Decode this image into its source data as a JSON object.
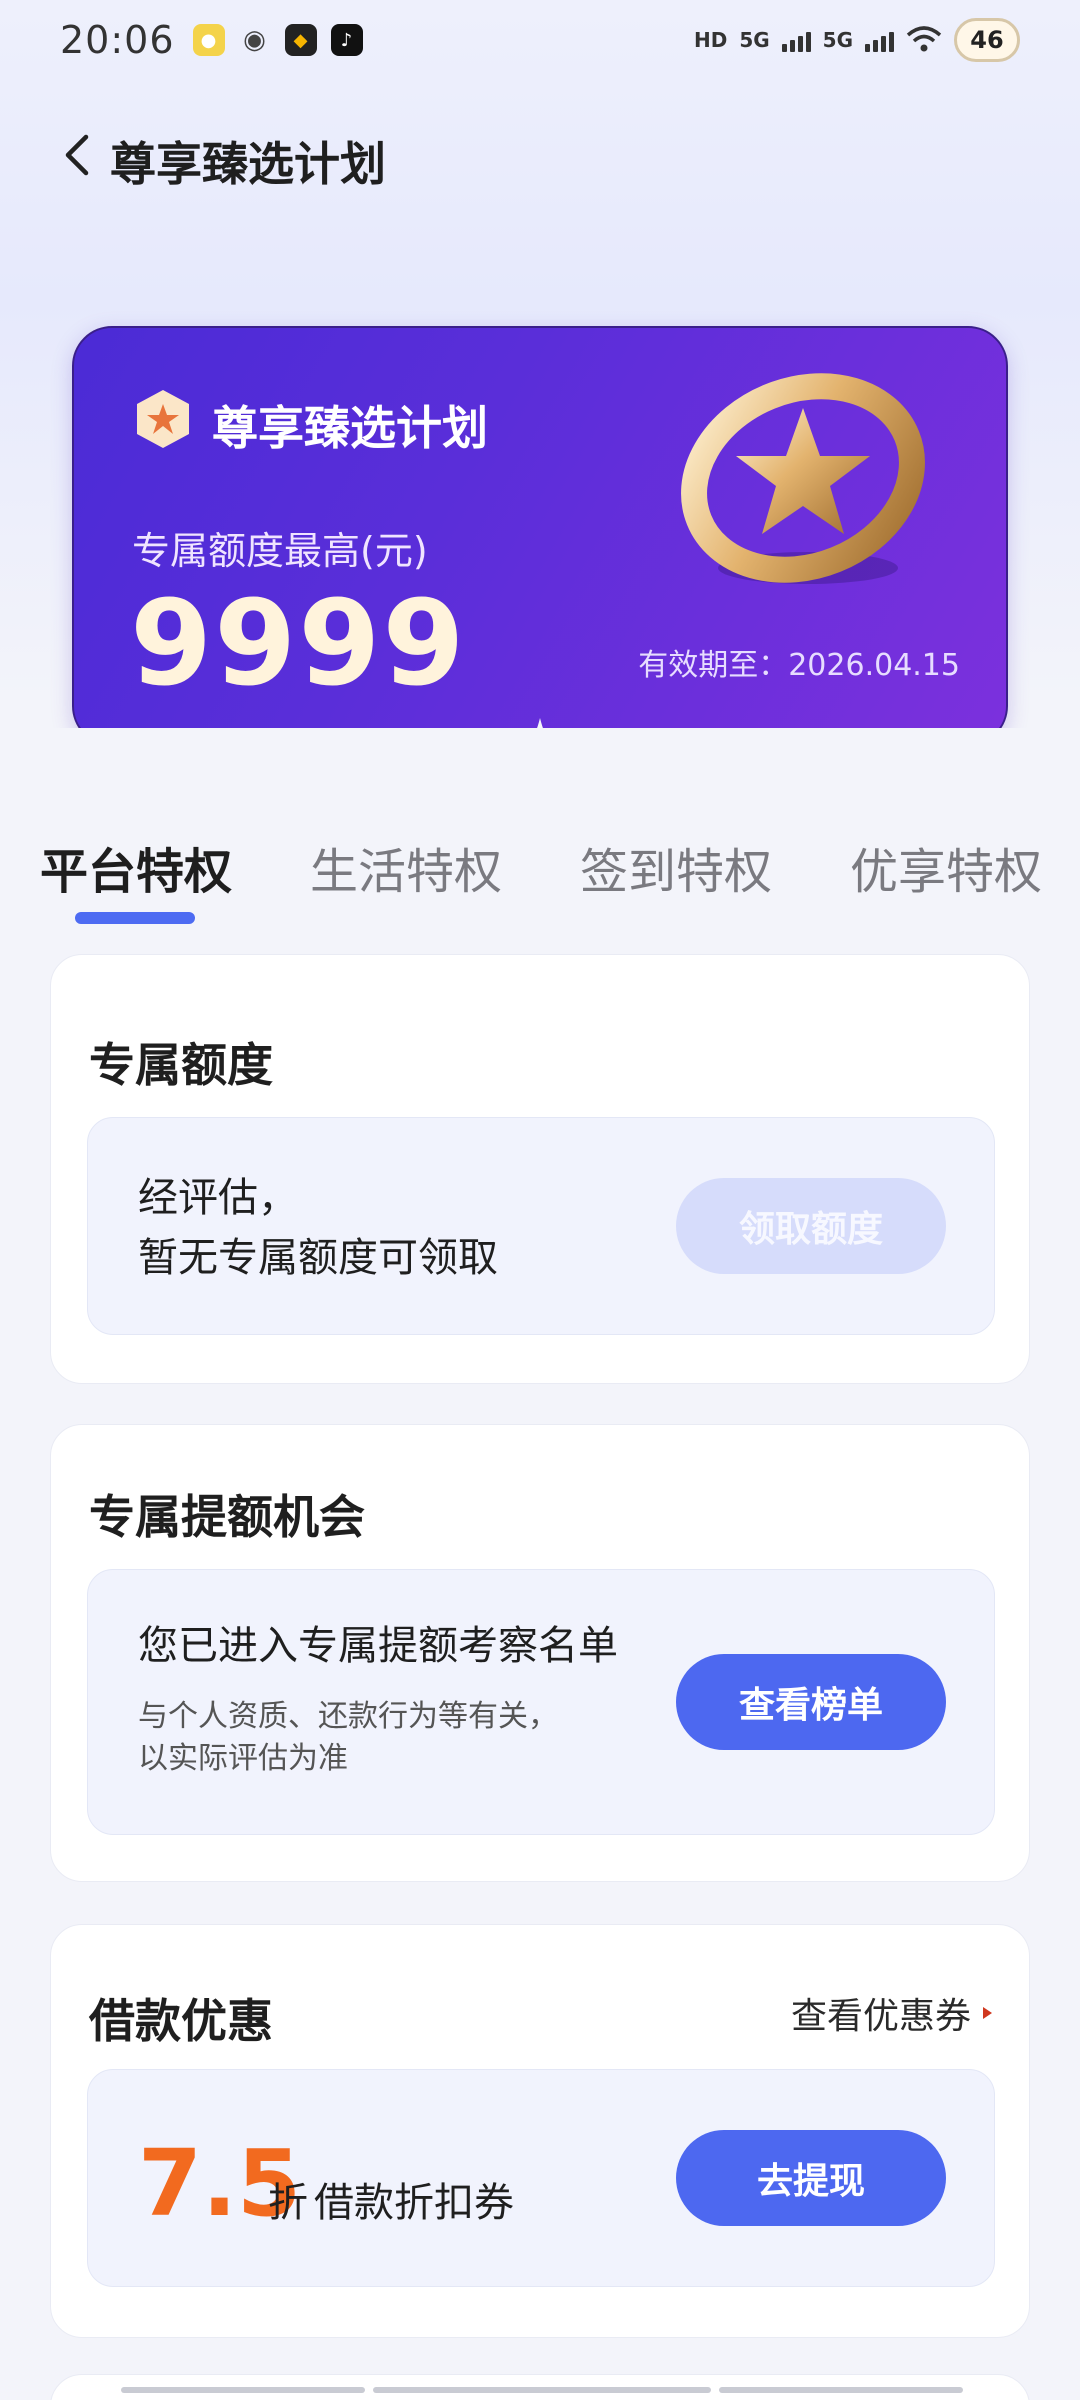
{
  "status": {
    "time": "20:06",
    "battery": "46",
    "hd": "HD",
    "net1": "5G",
    "net2": "5G"
  },
  "nav": {
    "title": "尊享臻选计划"
  },
  "hero": {
    "title": "尊享臻选计划",
    "subtitle": "专属额度最高(元)",
    "amount": "9999",
    "valid": "有效期至：2026.04.15"
  },
  "tabs": [
    {
      "label": "平台特权",
      "active": true
    },
    {
      "label": "生活特权",
      "active": false
    },
    {
      "label": "签到特权",
      "active": false
    },
    {
      "label": "优享特权",
      "active": false
    }
  ],
  "card_limit": {
    "title": "专属额度",
    "line1": "经评估，",
    "line2": "暂无专属额度可领取",
    "button": "领取额度"
  },
  "card_raise": {
    "title": "专属提额机会",
    "heading": "您已进入专属提额考察名单",
    "note1": "与个人资质、还款行为等有关，",
    "note2": "以实际评估为准",
    "button": "查看榜单"
  },
  "card_coupon": {
    "title": "借款优惠",
    "link": "查看优惠券",
    "discount": "7.5",
    "unit": "折",
    "name": "借款折扣券",
    "button": "去提现"
  },
  "colors": {
    "accent": "#4d68f0",
    "discount": "#f26a1f",
    "hero_start": "#4b2bd6",
    "hero_end": "#7c30dd"
  }
}
